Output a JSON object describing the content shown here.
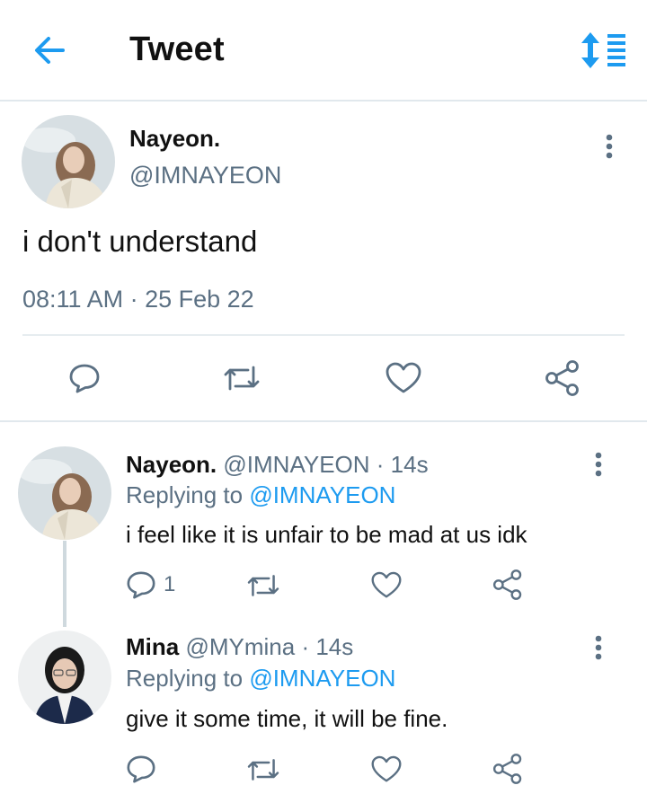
{
  "header": {
    "title": "Tweet",
    "back_icon": "arrow-left-icon",
    "sort_icon": "sort-icon",
    "accent": "#1d9bf0"
  },
  "main_tweet": {
    "name": "Nayeon.",
    "handle": "@IMNAYEON",
    "text": "i don't understand",
    "timestamp": "08:11 AM · 25 Feb 22",
    "actions": [
      "reply-icon",
      "retweet-icon",
      "like-icon",
      "share-icon"
    ]
  },
  "replies": [
    {
      "name": "Nayeon.",
      "meta": "@IMNAYEON · 14s",
      "replying_prefix": "Replying to ",
      "replying_to": "@IMNAYEON",
      "text": "i feel like it is unfair to be mad at us idk",
      "reply_count": "1"
    },
    {
      "name": "Mina",
      "meta": "@MYmina · 14s",
      "replying_prefix": "Replying to ",
      "replying_to": "@IMNAYEON",
      "text": "give it some time, it will be fine.",
      "reply_count": ""
    }
  ]
}
